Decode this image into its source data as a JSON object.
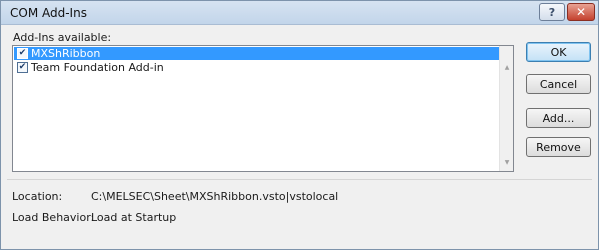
{
  "window": {
    "title": "COM Add-Ins",
    "help_glyph": "?",
    "close_glyph": "✕"
  },
  "addins": {
    "label": "Add-Ins available:",
    "items": [
      {
        "label": "MXShRibbon",
        "checked": true,
        "selected": true
      },
      {
        "label": "Team Foundation Add-in",
        "checked": true,
        "selected": false
      }
    ]
  },
  "buttons": {
    "ok": "OK",
    "cancel": "Cancel",
    "add": "Add...",
    "remove": "Remove"
  },
  "details": {
    "location_label": "Location:",
    "location_value": "C:\\MELSEC\\Sheet\\MXShRibbon.vsto|vstolocal",
    "load_behavior_label": "Load Behavior:",
    "load_behavior_value": "Load at Startup"
  },
  "colors": {
    "selection": "#3399ff",
    "close_button": "#c4412e"
  },
  "icons": {
    "check": "✔",
    "scroll_up": "▲",
    "scroll_down": "▼"
  }
}
